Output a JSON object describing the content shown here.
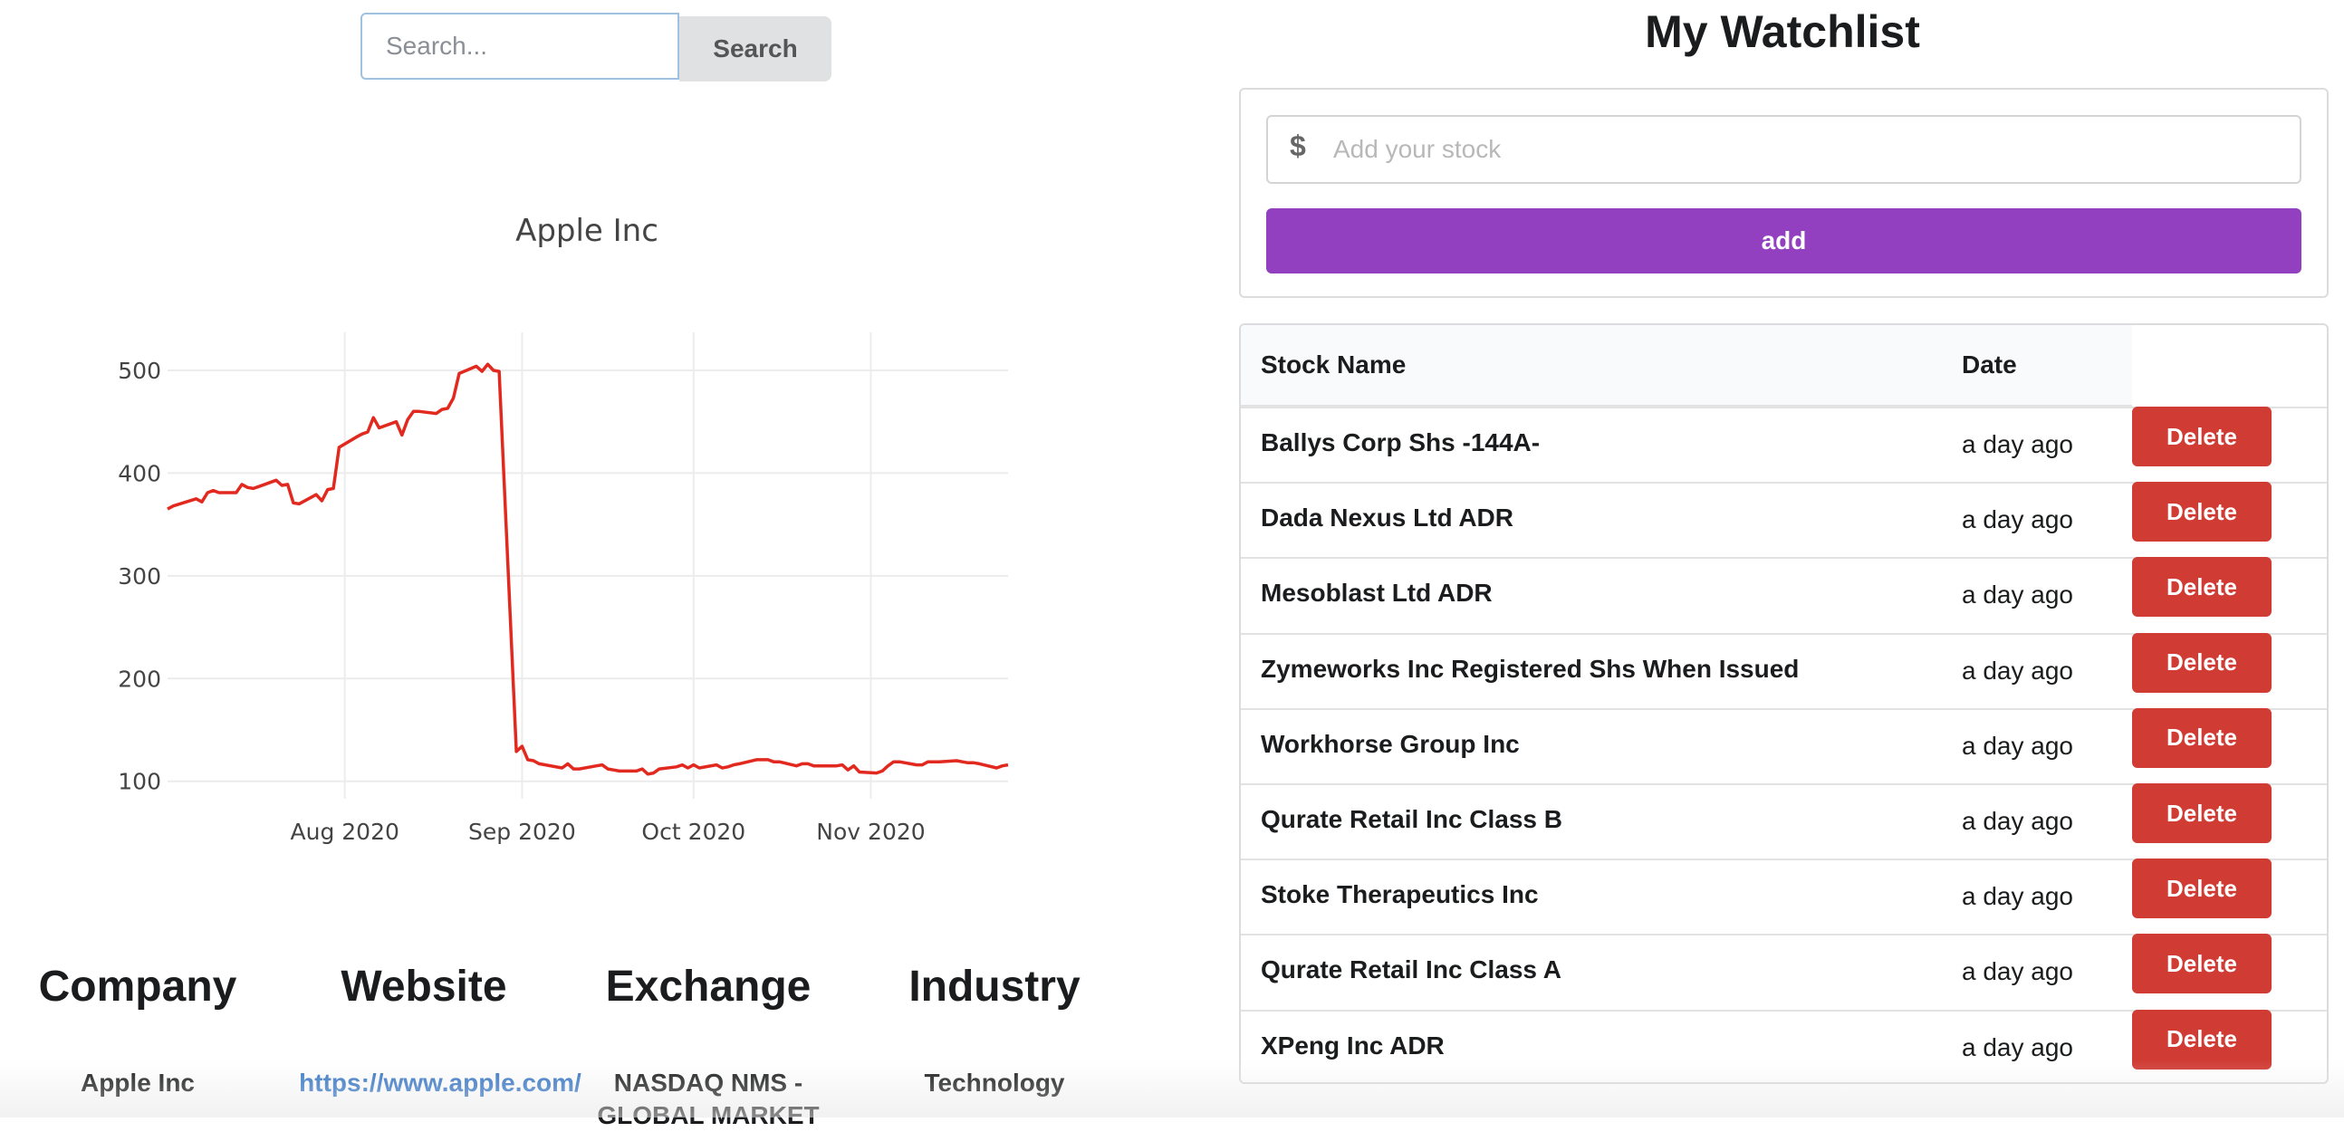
{
  "search": {
    "placeholder": "Search...",
    "button_label": "Search"
  },
  "chart_data": {
    "type": "line",
    "title": "Apple Inc",
    "xlabel": "",
    "ylabel": "",
    "x_ticks": [
      "Aug 2020",
      "Sep 2020",
      "Oct 2020",
      "Nov 2020"
    ],
    "y_ticks": [
      100,
      200,
      300,
      400,
      500
    ],
    "ylim": [
      83,
      537
    ],
    "xlim": [
      "2020-07-01",
      "2020-11-25"
    ],
    "grid": true,
    "line_color": "#e2291f",
    "series": [
      {
        "x": [
          "2020-07-01",
          "2020-07-02",
          "2020-07-06",
          "2020-07-07",
          "2020-07-08",
          "2020-07-09",
          "2020-07-10",
          "2020-07-13",
          "2020-07-14",
          "2020-07-15",
          "2020-07-16",
          "2020-07-17",
          "2020-07-20",
          "2020-07-21",
          "2020-07-22",
          "2020-07-23",
          "2020-07-24",
          "2020-07-27",
          "2020-07-28",
          "2020-07-29",
          "2020-07-30",
          "2020-07-31",
          "2020-08-03",
          "2020-08-04",
          "2020-08-05",
          "2020-08-06",
          "2020-08-07",
          "2020-08-10",
          "2020-08-11",
          "2020-08-12",
          "2020-08-13",
          "2020-08-14",
          "2020-08-17",
          "2020-08-18",
          "2020-08-19",
          "2020-08-20",
          "2020-08-21",
          "2020-08-24",
          "2020-08-25",
          "2020-08-26",
          "2020-08-27",
          "2020-08-28",
          "2020-08-31",
          "2020-09-01",
          "2020-09-02",
          "2020-09-03",
          "2020-09-04",
          "2020-09-08",
          "2020-09-09",
          "2020-09-10",
          "2020-09-11",
          "2020-09-14",
          "2020-09-15",
          "2020-09-16",
          "2020-09-17",
          "2020-09-18",
          "2020-09-21",
          "2020-09-22",
          "2020-09-23",
          "2020-09-24",
          "2020-09-25",
          "2020-09-28",
          "2020-09-29",
          "2020-09-30",
          "2020-10-01",
          "2020-10-02",
          "2020-10-05",
          "2020-10-06",
          "2020-10-07",
          "2020-10-08",
          "2020-10-09",
          "2020-10-12",
          "2020-10-13",
          "2020-10-14",
          "2020-10-15",
          "2020-10-16",
          "2020-10-19",
          "2020-10-20",
          "2020-10-21",
          "2020-10-22",
          "2020-10-23",
          "2020-10-26",
          "2020-10-27",
          "2020-10-28",
          "2020-10-29",
          "2020-10-30",
          "2020-11-02",
          "2020-11-03",
          "2020-11-04",
          "2020-11-05",
          "2020-11-06",
          "2020-11-09",
          "2020-11-10",
          "2020-11-11",
          "2020-11-12",
          "2020-11-13",
          "2020-11-16",
          "2020-11-17",
          "2020-11-18",
          "2020-11-19",
          "2020-11-20",
          "2020-11-23",
          "2020-11-24",
          "2020-11-25"
        ],
        "y": [
          365,
          368,
          375,
          372,
          381,
          383,
          381,
          381,
          389,
          386,
          385,
          387,
          393,
          388,
          389,
          371,
          370,
          379,
          373,
          384,
          385,
          425,
          435,
          438,
          440,
          454,
          444,
          450,
          437,
          452,
          460,
          460,
          458,
          462,
          463,
          473,
          497,
          504,
          499,
          506,
          500,
          499,
          129,
          134,
          121,
          120,
          117,
          113,
          117,
          112,
          112,
          115,
          116,
          112,
          111,
          110,
          110,
          112,
          107,
          108,
          112,
          114,
          116,
          113,
          116,
          113,
          116,
          113,
          114,
          116,
          117,
          121,
          121,
          121,
          119,
          119,
          115,
          117,
          117,
          115,
          115,
          115,
          116,
          111,
          115,
          109,
          108,
          110,
          115,
          119,
          119,
          116,
          116,
          119,
          119,
          119,
          120,
          119,
          118,
          118,
          117,
          113,
          115,
          116
        ]
      }
    ]
  },
  "info": {
    "headers": {
      "company": "Company",
      "website": "Website",
      "exchange": "Exchange",
      "industry": "Industry"
    },
    "values": {
      "company": "Apple Inc",
      "website": "https://www.apple.com/",
      "exchange": "NASDAQ NMS - GLOBAL MARKET",
      "industry": "Technology"
    }
  },
  "watchlist": {
    "title": "My Watchlist",
    "input_icon": "dollar-icon",
    "input_icon_glyph": "$",
    "input_placeholder": "Add your stock",
    "add_label": "add",
    "add_color": "#9240bf",
    "delete_color": "#d03b33",
    "columns": {
      "name": "Stock Name",
      "date": "Date"
    },
    "rows": [
      {
        "name": "Ballys Corp Shs -144A-",
        "date": "a day ago",
        "action": "Delete"
      },
      {
        "name": "Dada Nexus Ltd ADR",
        "date": "a day ago",
        "action": "Delete"
      },
      {
        "name": "Mesoblast Ltd ADR",
        "date": "a day ago",
        "action": "Delete"
      },
      {
        "name": "Zymeworks Inc Registered Shs When Issued",
        "date": "a day ago",
        "action": "Delete"
      },
      {
        "name": "Workhorse Group Inc",
        "date": "a day ago",
        "action": "Delete"
      },
      {
        "name": "Qurate Retail Inc Class B",
        "date": "a day ago",
        "action": "Delete"
      },
      {
        "name": "Stoke Therapeutics Inc",
        "date": "a day ago",
        "action": "Delete"
      },
      {
        "name": "Qurate Retail Inc Class A",
        "date": "a day ago",
        "action": "Delete"
      },
      {
        "name": "XPeng Inc ADR",
        "date": "a day ago",
        "action": "Delete"
      }
    ]
  }
}
